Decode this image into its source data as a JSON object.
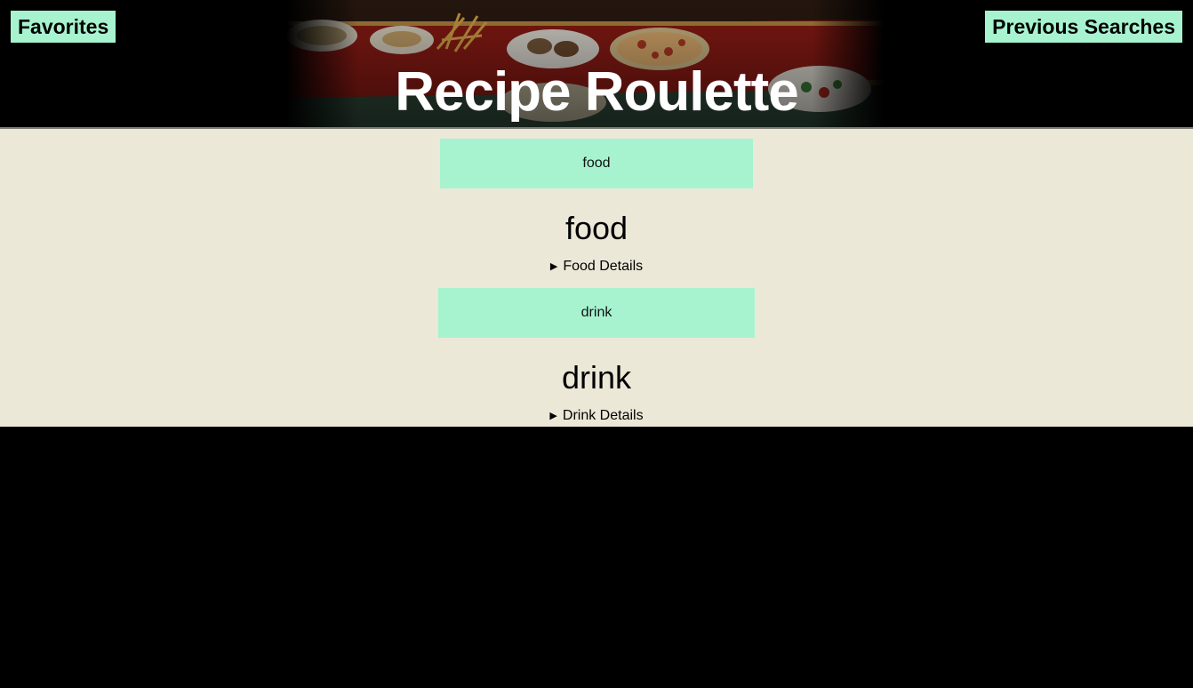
{
  "header": {
    "title": "Recipe Roulette",
    "favorites_label": "Favorites",
    "previous_searches_label": "Previous Searches",
    "banner_image": "food-platters-photo"
  },
  "food": {
    "button_label": "food",
    "heading": "food",
    "details_label": "Food Details",
    "toggle_icon": "triangle-right-icon"
  },
  "drink": {
    "button_label": "drink",
    "heading": "drink",
    "details_label": "Drink Details",
    "toggle_icon": "triangle-right-icon"
  },
  "colors": {
    "accent": "#a7f3d0",
    "content_background": "#ece8d8",
    "page_background": "#000000",
    "title_text": "#ffffff"
  }
}
